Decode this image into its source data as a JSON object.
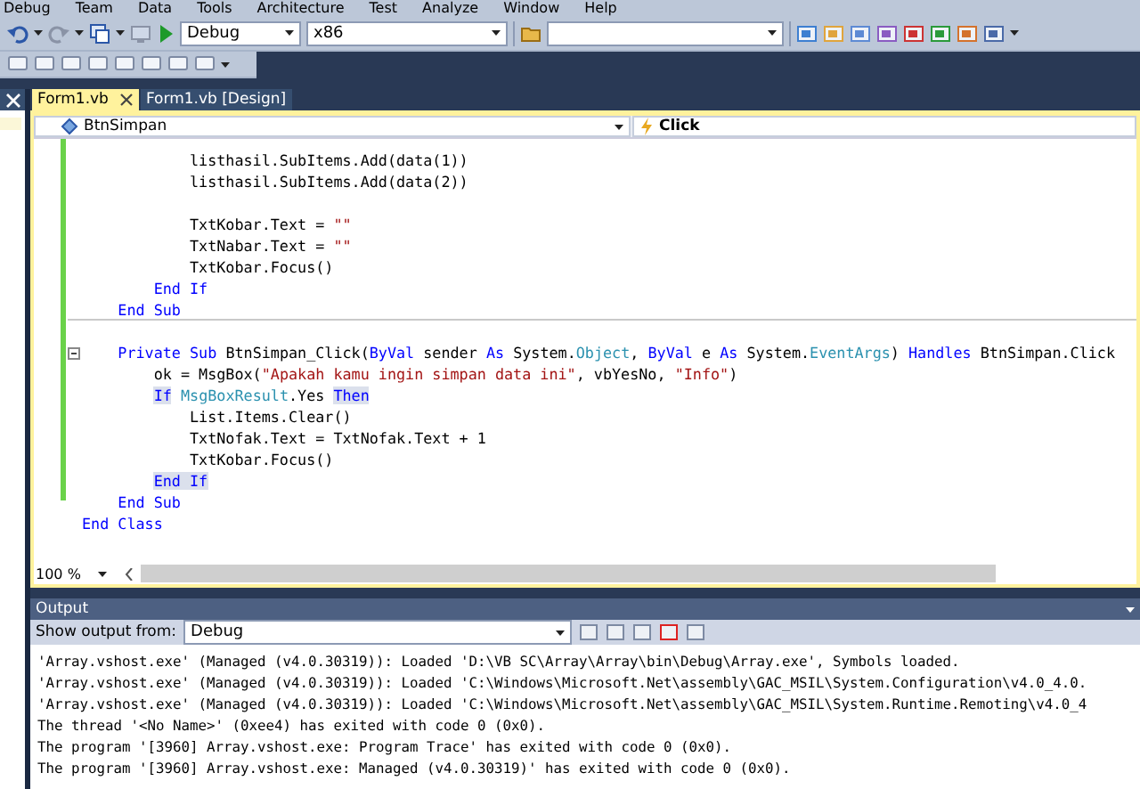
{
  "menu": [
    "Debug",
    "Team",
    "Data",
    "Tools",
    "Architecture",
    "Test",
    "Analyze",
    "Window",
    "Help"
  ],
  "toolbar": {
    "configuration": "Debug",
    "platform": "x86"
  },
  "tabs": [
    {
      "label": "Form1.vb",
      "selected": true
    },
    {
      "label": "Form1.vb [Design]",
      "selected": false
    }
  ],
  "navigation": {
    "object": "BtnSimpan",
    "event": "Click"
  },
  "code": [
    {
      "kind": "code",
      "tokens": [
        {
          "kind": "plain",
          "text": "            listhasil.SubItems.Add(data(1))"
        }
      ]
    },
    {
      "kind": "code",
      "tokens": [
        {
          "kind": "plain",
          "text": "            listhasil.SubItems.Add(data(2))"
        }
      ]
    },
    {
      "kind": "blank"
    },
    {
      "kind": "code",
      "tokens": [
        {
          "kind": "plain",
          "text": "            TxtKobar.Text = "
        },
        {
          "kind": "string",
          "text": "\"\""
        }
      ]
    },
    {
      "kind": "code",
      "tokens": [
        {
          "kind": "plain",
          "text": "            TxtNabar.Text = "
        },
        {
          "kind": "string",
          "text": "\"\""
        }
      ]
    },
    {
      "kind": "code",
      "tokens": [
        {
          "kind": "plain",
          "text": "            TxtKobar.Focus()"
        }
      ]
    },
    {
      "kind": "code",
      "tokens": [
        {
          "kind": "keyword",
          "text": "        End If"
        }
      ]
    },
    {
      "kind": "code",
      "separator_after": true,
      "tokens": [
        {
          "kind": "keyword",
          "text": "    End Sub"
        }
      ]
    },
    {
      "kind": "blank"
    },
    {
      "kind": "code",
      "expanded": true,
      "tokens": [
        {
          "kind": "keyword",
          "text": "    Private Sub"
        },
        {
          "kind": "plain",
          "text": " BtnSimpan_Click("
        },
        {
          "kind": "keyword",
          "text": "ByVal"
        },
        {
          "kind": "plain",
          "text": " sender "
        },
        {
          "kind": "keyword",
          "text": "As"
        },
        {
          "kind": "plain",
          "text": " System."
        },
        {
          "kind": "type",
          "text": "Object"
        },
        {
          "kind": "plain",
          "text": ", "
        },
        {
          "kind": "keyword",
          "text": "ByVal"
        },
        {
          "kind": "plain",
          "text": " e "
        },
        {
          "kind": "keyword",
          "text": "As"
        },
        {
          "kind": "plain",
          "text": " System."
        },
        {
          "kind": "type",
          "text": "EventArgs"
        },
        {
          "kind": "plain",
          "text": ") "
        },
        {
          "kind": "keyword",
          "text": "Handles"
        },
        {
          "kind": "plain",
          "text": " BtnSimpan.Click"
        }
      ]
    },
    {
      "kind": "code",
      "tokens": [
        {
          "kind": "plain",
          "text": "        ok = MsgBox("
        },
        {
          "kind": "string",
          "text": "\"Apakah kamu ingin simpan data ini\""
        },
        {
          "kind": "plain",
          "text": ", vbYesNo, "
        },
        {
          "kind": "string",
          "text": "\"Info\""
        },
        {
          "kind": "plain",
          "text": ")"
        }
      ]
    },
    {
      "kind": "code",
      "tokens": [
        {
          "kind": "matched",
          "text": "        If"
        },
        {
          "kind": "type",
          "text": " MsgBoxResult"
        },
        {
          "kind": "plain",
          "text": ".Yes "
        },
        {
          "kind": "matched",
          "text": "Then"
        }
      ]
    },
    {
      "kind": "code",
      "tokens": [
        {
          "kind": "plain",
          "text": "            List.Items.Clear()"
        }
      ]
    },
    {
      "kind": "code",
      "tokens": [
        {
          "kind": "plain",
          "text": "            TxtNofak.Text = TxtNofak.Text + 1"
        }
      ]
    },
    {
      "kind": "code",
      "tokens": [
        {
          "kind": "plain",
          "text": "            TxtKobar.Focus()"
        }
      ]
    },
    {
      "kind": "code",
      "tokens": [
        {
          "kind": "matched",
          "text": "        End If"
        }
      ]
    },
    {
      "kind": "code",
      "tokens": [
        {
          "kind": "keyword",
          "text": "    End Sub"
        }
      ]
    },
    {
      "kind": "code",
      "tokens": [
        {
          "kind": "keyword",
          "text": "End Class"
        }
      ]
    }
  ],
  "zoom": "100 %",
  "output": {
    "title": "Output",
    "source_label": "Show output from:",
    "source": "Debug",
    "lines": [
      "'Array.vshost.exe' (Managed (v4.0.30319)): Loaded 'D:\\VB SC\\Array\\Array\\bin\\Debug\\Array.exe', Symbols loaded.",
      "'Array.vshost.exe' (Managed (v4.0.30319)): Loaded 'C:\\Windows\\Microsoft.Net\\assembly\\GAC_MSIL\\System.Configuration\\v4.0_4.0.",
      "'Array.vshost.exe' (Managed (v4.0.30319)): Loaded 'C:\\Windows\\Microsoft.Net\\assembly\\GAC_MSIL\\System.Runtime.Remoting\\v4.0_4",
      "The thread '<No Name>' (0xee4) has exited with code 0 (0x0).",
      "The program '[3960] Array.vshost.exe: Program Trace' has exited with code 0 (0x0).",
      "The program '[3960] Array.vshost.exe: Managed (v4.0.30319)' has exited with code 0 (0x0)."
    ]
  }
}
